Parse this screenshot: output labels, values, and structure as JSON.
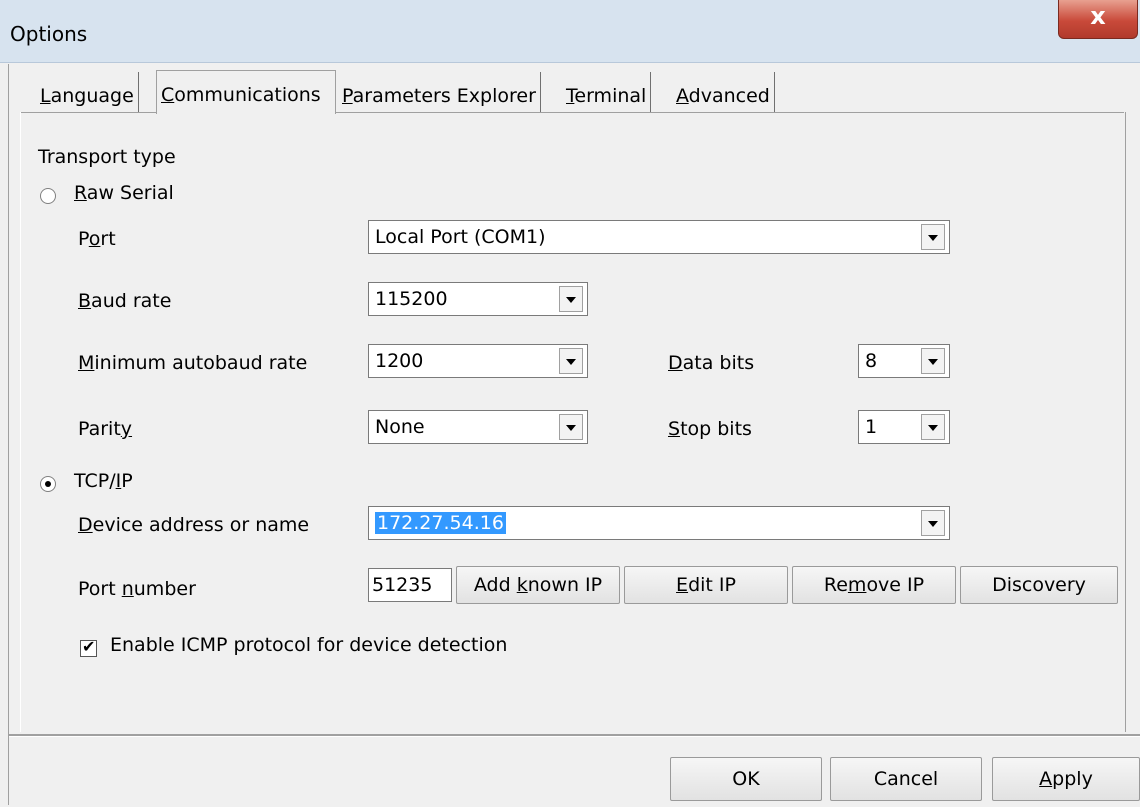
{
  "window": {
    "title": "Options",
    "close_symbol": "x"
  },
  "tabs": [
    {
      "label_pre": "",
      "label_ul": "L",
      "label_post": "anguage"
    },
    {
      "label_pre": "",
      "label_ul": "C",
      "label_post": "ommunications"
    },
    {
      "label_pre": "",
      "label_ul": "P",
      "label_post": "arameters Explorer"
    },
    {
      "label_pre": "",
      "label_ul": "T",
      "label_post": "erminal"
    },
    {
      "label_pre": "",
      "label_ul": "A",
      "label_post": "dvanced"
    }
  ],
  "active_tab": "Communications",
  "transport": {
    "heading": "Transport type",
    "raw_serial": {
      "pre": "",
      "ul": "R",
      "post": "aw Serial",
      "selected": false
    },
    "tcpip": {
      "pre": "TCP/",
      "ul": "I",
      "post": "P",
      "selected": true
    }
  },
  "serial": {
    "port": {
      "pre": "P",
      "ul": "o",
      "post": "rt",
      "value": "Local Port (COM1)"
    },
    "baud": {
      "pre": "",
      "ul": "B",
      "post": "aud rate",
      "value": "115200"
    },
    "min_autobaud": {
      "pre": "",
      "ul": "M",
      "post": "inimum autobaud rate",
      "value": "1200"
    },
    "parity": {
      "pre": "Parit",
      "ul": "y",
      "post": "",
      "value": "None"
    },
    "data_bits": {
      "pre": "",
      "ul": "D",
      "post": "ata bits",
      "value": "8"
    },
    "stop_bits": {
      "pre": "",
      "ul": "S",
      "post": "top bits",
      "value": "1"
    }
  },
  "tcp": {
    "device_address": {
      "pre": "",
      "ul": "D",
      "post": "evice address or name",
      "value": "172.27.54.16"
    },
    "port_number": {
      "pre": "Port ",
      "ul": "n",
      "post": "umber",
      "value": "51235"
    },
    "buttons": {
      "add_known_ip": {
        "pre": "Add ",
        "ul": "k",
        "post": "nown IP"
      },
      "edit_ip": {
        "pre": "",
        "ul": "E",
        "post": "dit IP"
      },
      "remove_ip": {
        "pre": "Re",
        "ul": "m",
        "post": "ove IP"
      },
      "discovery": "Discovery"
    },
    "icmp": {
      "label": "Enable ICMP protocol for device detection",
      "checked": true
    }
  },
  "footer": {
    "ok": "OK",
    "cancel": "Cancel",
    "apply": {
      "pre": "",
      "ul": "A",
      "post": "pply"
    }
  }
}
